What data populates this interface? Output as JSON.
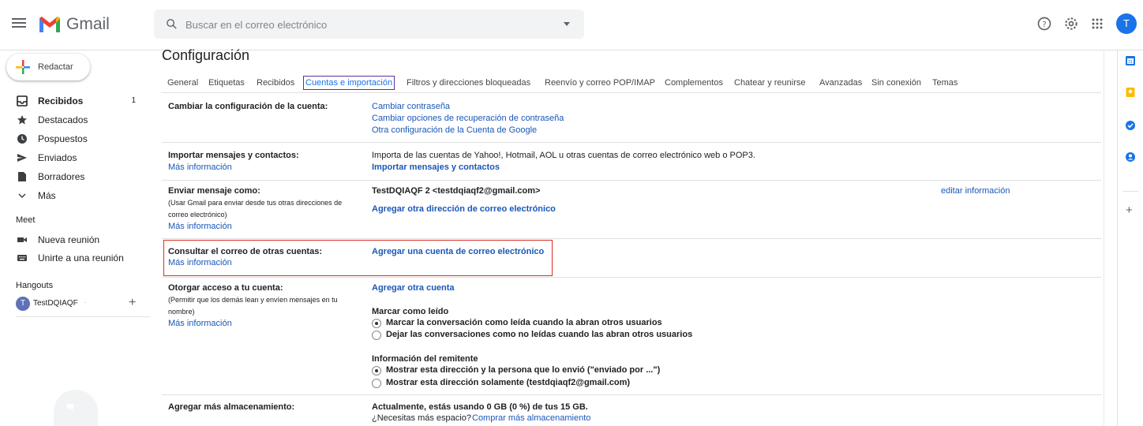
{
  "header": {
    "app_name": "Gmail",
    "search_placeholder": "Buscar en el correo electrónico",
    "avatar_letter": "T"
  },
  "compose": {
    "label": "Redactar"
  },
  "nav": {
    "items": [
      {
        "label": "Recibidos",
        "count": "1",
        "icon": "inbox-icon"
      },
      {
        "label": "Destacados",
        "icon": "star-icon"
      },
      {
        "label": "Pospuestos",
        "icon": "clock-icon"
      },
      {
        "label": "Enviados",
        "icon": "send-icon"
      },
      {
        "label": "Borradores",
        "icon": "draft-icon"
      },
      {
        "label": "Más",
        "icon": "chevron-down-icon"
      }
    ],
    "meet_title": "Meet",
    "meet_items": [
      {
        "label": "Nueva reunión",
        "icon": "video-icon"
      },
      {
        "label": "Unirte a una reunión",
        "icon": "keyboard-icon"
      }
    ],
    "hangouts_title": "Hangouts",
    "hangouts_user": {
      "avatar": "T",
      "name": "TestDQIAQF",
      "status": "·"
    }
  },
  "settings": {
    "title": "Configuración",
    "tabs": [
      "General",
      "Etiquetas",
      "Recibidos",
      "Cuentas e importación",
      "Filtros y direcciones bloqueadas",
      "Reenvío y correo POP/IMAP",
      "Complementos",
      "Chatear y reunirse",
      "Avanzadas",
      "Sin conexión",
      "Temas"
    ],
    "active_tab": "Cuentas e importación",
    "rows": {
      "account": {
        "label": "Cambiar la configuración de la cuenta:",
        "links": [
          "Cambiar contraseña",
          "Cambiar opciones de recuperación de contraseña",
          "Otra configuración de la Cuenta de Google"
        ]
      },
      "import": {
        "label": "Importar mensajes y contactos:",
        "more": "Más información",
        "desc": "Importa de las cuentas de Yahoo!, Hotmail, AOL u otras cuentas de correo electrónico web o POP3.",
        "action": "Importar mensajes y contactos"
      },
      "send_as": {
        "label": "Enviar mensaje como:",
        "sub": "(Usar Gmail para enviar desde tus otras direcciones de correo electrónico)",
        "more": "Más información",
        "address": "TestDQIAQF 2 <testdqiaqf2@gmail.com>",
        "edit": "editar información",
        "add": "Agregar otra dirección de correo electrónico"
      },
      "check_mail": {
        "label": "Consultar el correo de otras cuentas:",
        "more": "Más información",
        "action": "Agregar una cuenta de correo electrónico"
      },
      "grant": {
        "label": "Otorgar acceso a tu cuenta:",
        "sub": "(Permitir que los demás lean y envíen mensajes en tu nombre)",
        "more": "Más información",
        "add": "Agregar otra cuenta",
        "mark_read_title": "Marcar como leído",
        "mark_read_opt1": "Marcar la conversación como leída cuando la abran otros usuarios",
        "mark_read_opt2": "Dejar las conversaciones como no leídas cuando las abran otros usuarios",
        "sender_title": "Información del remitente",
        "sender_opt1": "Mostrar esta dirección y la persona que lo envió (\"enviado por ...\")",
        "sender_opt2": "Mostrar esta dirección solamente (testdqiaqf2@gmail.com)"
      },
      "storage": {
        "label": "Agregar más almacenamiento:",
        "usage": "Actualmente, estás usando 0 GB (0 %) de tus 15 GB.",
        "need": "¿Necesitas más espacio?",
        "buy": "Comprar más almacenamiento"
      }
    }
  },
  "colors": {
    "link": "#1a57b8",
    "highlight": "#d93025",
    "active_tab_outline": "#5b2ea8"
  }
}
